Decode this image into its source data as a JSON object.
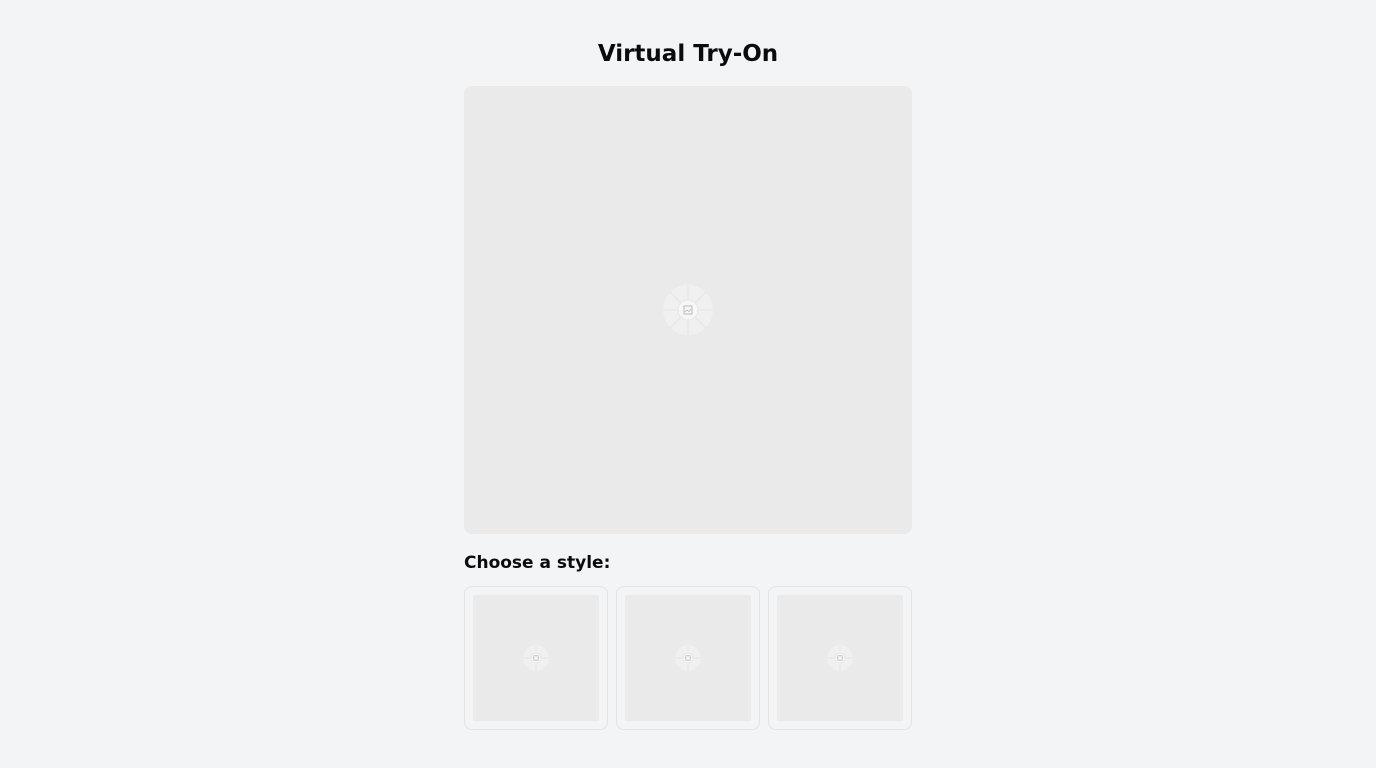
{
  "header": {
    "title": "Virtual Try-On"
  },
  "preview": {
    "icon": "image-placeholder-icon"
  },
  "styles": {
    "label": "Choose a style:",
    "items": [
      {
        "icon": "image-placeholder-icon"
      },
      {
        "icon": "image-placeholder-icon"
      },
      {
        "icon": "image-placeholder-icon"
      }
    ]
  },
  "colors": {
    "background": "#f3f4f6",
    "placeholder": "#eaeaea",
    "border": "#e2e3e6",
    "text": "#0b0b0f"
  }
}
